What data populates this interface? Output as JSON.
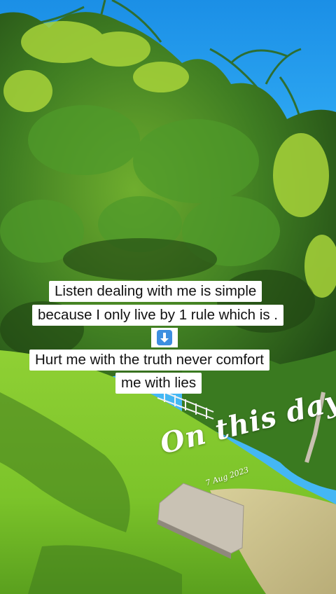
{
  "caption": {
    "line1": "Listen dealing with me is simple",
    "line2": "because I only live by 1 rule  which is .",
    "arrow_icon": "down-arrow-emoji-icon",
    "line3": "Hurt me with the truth never comfort",
    "line4": "me with lies"
  },
  "memory": {
    "title": "On this day",
    "date": "7 Aug 2023"
  },
  "colors": {
    "sky": "#2aa3f0",
    "foliage_dark": "#2f6a1f",
    "foliage_mid": "#4f9a2a",
    "foliage_light": "#a8d43a",
    "grass": "#7cc42a",
    "arrow_key": "#3d8fe0"
  }
}
